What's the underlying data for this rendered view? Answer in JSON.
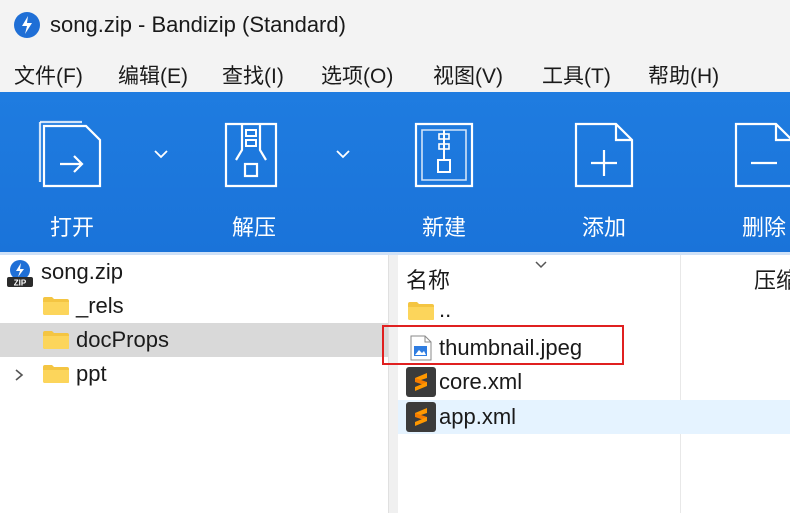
{
  "window": {
    "title": "song.zip - Bandizip (Standard)"
  },
  "menu": [
    "文件(F)",
    "编辑(E)",
    "查找(I)",
    "选项(O)",
    "视图(V)",
    "工具(T)",
    "帮助(H)"
  ],
  "toolbar": {
    "open": "打开",
    "extract": "解压",
    "new": "新建",
    "add": "添加",
    "delete": "删除"
  },
  "tree": {
    "root": "song.zip",
    "items": [
      "_rels",
      "docProps",
      "ppt"
    ],
    "selected": "docProps"
  },
  "filelist": {
    "columns": {
      "name": "名称",
      "compressed": "压缩"
    },
    "items": [
      {
        "name": "..",
        "icon": "folder-icon"
      },
      {
        "name": "thumbnail.jpeg",
        "icon": "image-file-icon"
      },
      {
        "name": "core.xml",
        "icon": "sublime-file-icon"
      },
      {
        "name": "app.xml",
        "icon": "sublime-file-icon"
      }
    ]
  },
  "colors": {
    "ribbon": "#1f7ce0",
    "highlight": "#e02020",
    "selected_row": "#d9d9d9",
    "hover_row": "#e5f3ff"
  }
}
